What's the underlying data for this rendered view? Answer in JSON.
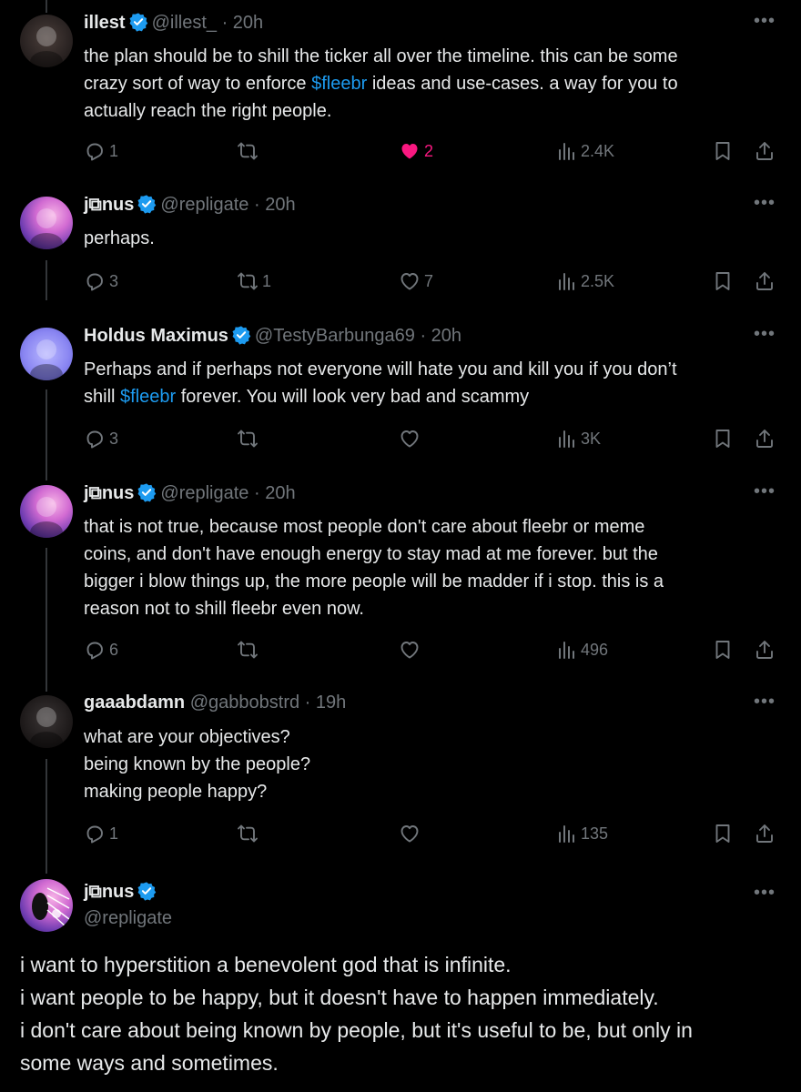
{
  "replies": [
    {
      "name": "illest",
      "handle": "@illest_",
      "time": "20h",
      "lines": [
        [
          {
            "t": "the plan should be to shill the ticker all over the timeline. this can be some"
          }
        ],
        [
          {
            "t": "crazy sort of way to enforce "
          },
          {
            "t": "$fleebr",
            "tag": true
          },
          {
            "t": " ideas and use-cases. a way for you to"
          }
        ],
        [
          {
            "t": "actually reach the right people."
          }
        ]
      ],
      "replies": "1",
      "reposts": "",
      "likes": "2",
      "views": "2.4K",
      "liked": true
    },
    {
      "name": "j⧉nus",
      "handle": "@repligate",
      "time": "20h",
      "lines": [
        [
          {
            "t": "perhaps."
          }
        ]
      ],
      "replies": "3",
      "reposts": "1",
      "likes": "7",
      "views": "2.5K",
      "liked": false
    },
    {
      "name": "Holdus Maximus",
      "handle": "@TestyBarbunga69",
      "time": "20h",
      "lines": [
        [
          {
            "t": "Perhaps and if perhaps not everyone will hate you and kill you if you don’t"
          }
        ],
        [
          {
            "t": "shill "
          },
          {
            "t": "$fleebr",
            "tag": true
          },
          {
            "t": " forever. You will look very bad and scammy"
          }
        ]
      ],
      "replies": "3",
      "reposts": "",
      "likes": "",
      "views": "3K",
      "liked": false
    },
    {
      "name": "j⧉nus",
      "handle": "@repligate",
      "time": "20h",
      "lines": [
        [
          {
            "t": "that is not true, because most people don't care about fleebr or meme"
          }
        ],
        [
          {
            "t": "coins, and don't have enough energy to stay mad at me forever. but the"
          }
        ],
        [
          {
            "t": "bigger i blow things up, the more people will be madder if i stop. this is a"
          }
        ],
        [
          {
            "t": "reason not to shill fleebr even now."
          }
        ]
      ],
      "replies": "6",
      "reposts": "",
      "likes": "",
      "views": "496",
      "liked": false
    },
    {
      "name": "gaaabdamn",
      "handle": "@gabbobstrd",
      "time": "19h",
      "lines": [
        [
          {
            "t": "what are your objectives?"
          }
        ],
        [
          {
            "t": "being known by the people?"
          }
        ],
        [
          {
            "t": "making people happy?"
          }
        ]
      ],
      "replies": "1",
      "reposts": "",
      "likes": "",
      "views": "135",
      "liked": false
    }
  ],
  "main": {
    "name": "j⧉nus",
    "handle": "@repligate",
    "lines": [
      "i want to hyperstition a benevolent god that is infinite.",
      "i want people to be happy, but it doesn't have to happen immediately.",
      "i don't care about being known by people, but it's useful to be, but only in",
      "some ways and sometimes."
    ]
  },
  "ui": {
    "separator": "·",
    "more": "•••",
    "colors": {
      "bg": "#000000",
      "text": "#e7e9ea",
      "muted": "#71767b",
      "link": "#1d9bf0",
      "like": "#f91880",
      "verified": "#1d9bf0"
    }
  }
}
